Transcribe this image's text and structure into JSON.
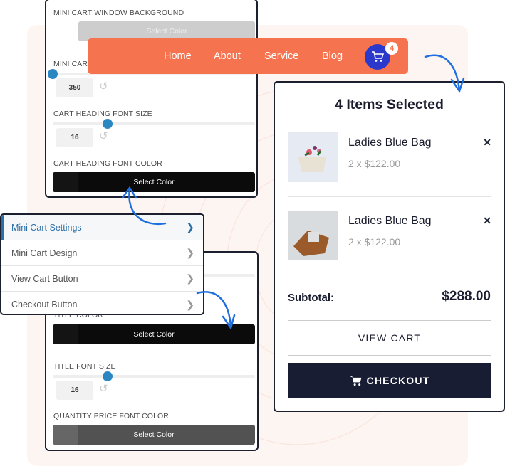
{
  "top_panel": {
    "bg_label": "MINI CART WINDOW BACKGROUND",
    "bg_btn": "Select Color",
    "width_label": "MINI CART",
    "width_value": "350",
    "width_fraction": 0.0,
    "heading_size_label": "CART HEADING FONT SIZE",
    "heading_size_value": "16",
    "heading_size_fraction": 0.27,
    "heading_color_label": "CART HEADING FONT COLOR",
    "heading_color_btn": "Select Color"
  },
  "nav": {
    "items": [
      "Home",
      "About",
      "Service",
      "Blog"
    ],
    "cart_count": "4",
    "color": "#f5734f",
    "cart_color": "#2a38cc"
  },
  "cart": {
    "title": "4 Items Selected",
    "items": [
      {
        "name": "Ladies Blue Bag",
        "price": "2 x $122.00"
      },
      {
        "name": "Ladies Blue Bag",
        "price": "2 x $122.00"
      }
    ],
    "subtotal_label": "Subtotal:",
    "subtotal_value": "$288.00",
    "view_cart": "VIEW CART",
    "checkout": "CHECKOUT"
  },
  "menu": {
    "items": [
      "Mini Cart Settings",
      "Mini Cart Design",
      "View Cart Button",
      "Checkout Button"
    ]
  },
  "bottom_panel": {
    "title_color_label": "TITLE COLOR",
    "title_color_btn": "Select Color",
    "title_size_label": "TITLE FONT SIZE",
    "title_size_value": "16",
    "title_size_fraction": 0.27,
    "qty_color_label": "QUANTITY PRICE FONT COLOR",
    "qty_color_btn": "Select Color"
  }
}
